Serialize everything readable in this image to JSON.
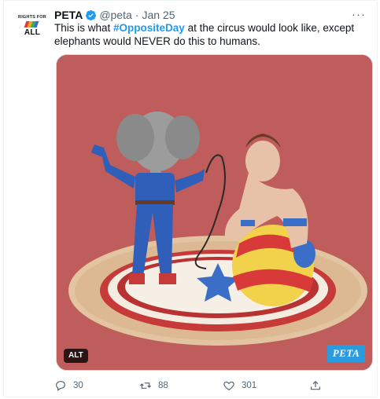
{
  "tweet": {
    "avatar": {
      "top_text": "RIGHTS FOR",
      "bottom_text": "ALL"
    },
    "display_name": "PETA",
    "handle": "@peta",
    "separator": "·",
    "date": "Jan 25",
    "more": "···",
    "text_before": "This is what ",
    "hashtag": "#OppositeDay",
    "text_after": " at the circus would look like, except elephants would NEVER do this to humans.",
    "media": {
      "alt_badge": "ALT",
      "logo_text": "PETA"
    },
    "actions": {
      "replies": "30",
      "retweets": "88",
      "likes": "301"
    }
  },
  "colors": {
    "accent": "#1d9bf0",
    "media_background": "#bf5c5c",
    "secondary_text": "#536471"
  },
  "icons": [
    "verified-badge-icon",
    "more-icon",
    "reply-icon",
    "retweet-icon",
    "like-icon",
    "share-icon"
  ]
}
